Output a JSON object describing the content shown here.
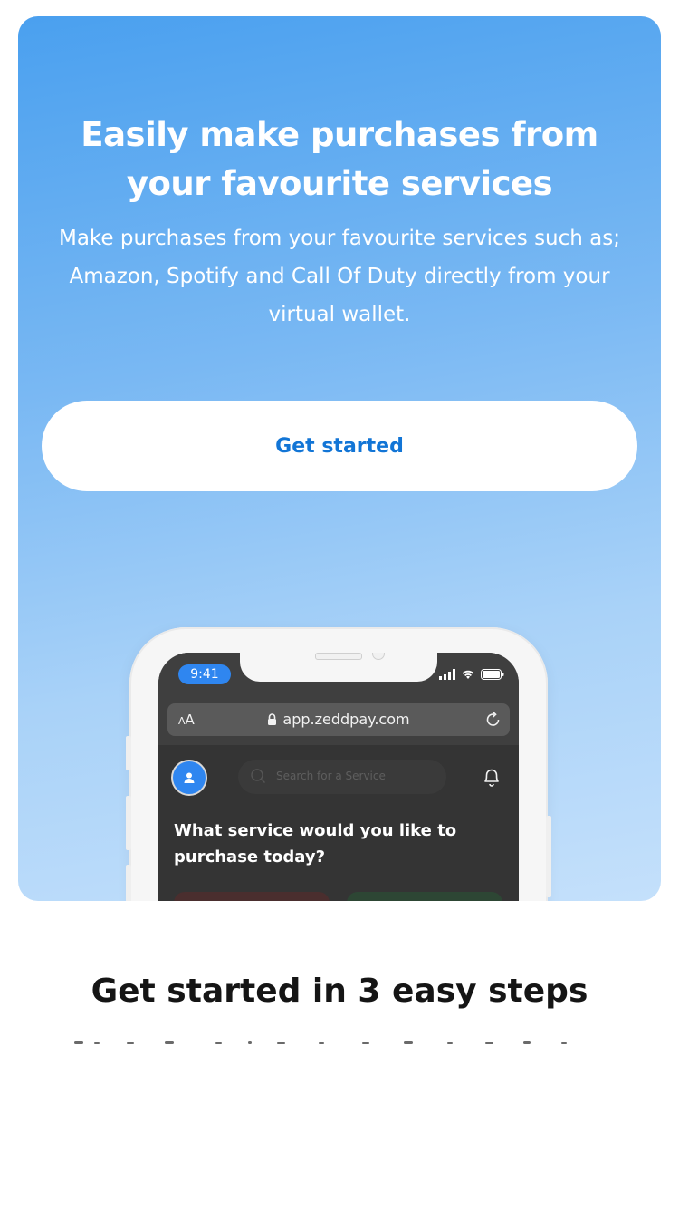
{
  "hero": {
    "title": "Easily make purchases from your favourite services",
    "subtitle": "Make purchases from your favourite services such as; Amazon, Spotify and Call Of Duty directly from your virtual wallet.",
    "cta_label": "Get started"
  },
  "phone": {
    "status_time": "9:41",
    "browser": {
      "text_size_label": "AA",
      "url": "app.zeddpay.com"
    },
    "app": {
      "search_placeholder": "Search for a Service",
      "question": "What service would you like to purchase today?"
    },
    "icons": [
      "signal-icon",
      "wifi-icon",
      "battery-icon",
      "lock-icon",
      "reload-icon",
      "user-icon",
      "search-icon",
      "bell-icon"
    ]
  },
  "steps": {
    "title": "Get started in 3 easy steps"
  },
  "colors": {
    "gradient_start": "#4aa0ef",
    "gradient_end": "#c4e0fb",
    "accent": "#1275d6",
    "phone_screen": "#343434"
  }
}
